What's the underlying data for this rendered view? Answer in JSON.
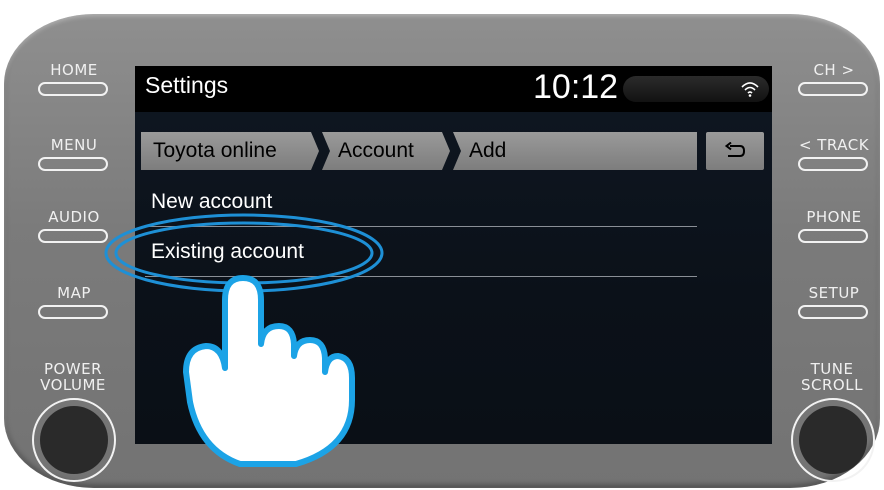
{
  "device": {
    "left_buttons": [
      "HOME",
      "MENU",
      "AUDIO",
      "MAP"
    ],
    "right_buttons": [
      "CH >",
      "< TRACK",
      "PHONE",
      "SETUP"
    ],
    "left_knob_label": [
      "POWER",
      "VOLUME"
    ],
    "right_knob_label": [
      "TUNE",
      "SCROLL"
    ]
  },
  "screen": {
    "title": "Settings",
    "clock": "10:12",
    "status_icon": "wifi-icon",
    "breadcrumbs": [
      "Toyota online",
      "Account",
      "Add"
    ],
    "back_icon": "return-arrow-icon",
    "list": [
      "New account",
      "Existing account"
    ]
  },
  "colors": {
    "bezel": "#808080",
    "screen_bg": "#0d141d",
    "highlight_ring": "#1e90d6"
  }
}
